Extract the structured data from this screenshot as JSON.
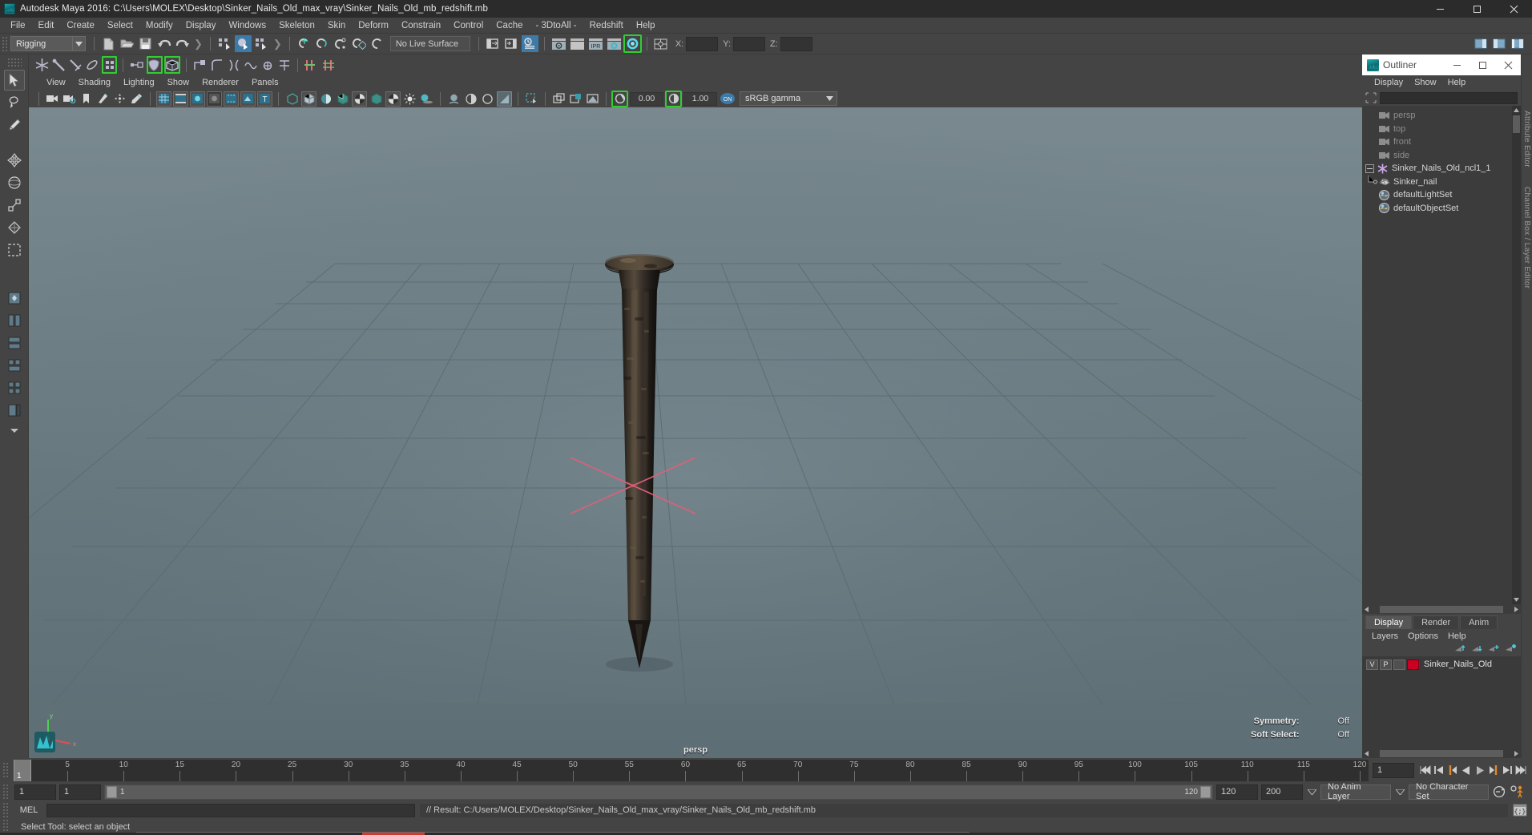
{
  "window": {
    "title": "Autodesk Maya 2016: C:\\Users\\MOLEX\\Desktop\\Sinker_Nails_Old_max_vray\\Sinker_Nails_Old_mb_redshift.mb",
    "app_icon": "maya-icon",
    "minimize": "minimize-icon",
    "maximize": "maximize-icon",
    "close": "close-icon"
  },
  "menubar": {
    "items": [
      {
        "label": "File"
      },
      {
        "label": "Edit"
      },
      {
        "label": "Create"
      },
      {
        "label": "Select"
      },
      {
        "label": "Modify"
      },
      {
        "label": "Display"
      },
      {
        "label": "Windows"
      },
      {
        "label": "Skeleton"
      },
      {
        "label": "Skin"
      },
      {
        "label": "Deform"
      },
      {
        "label": "Constrain"
      },
      {
        "label": "Control"
      },
      {
        "label": "Cache"
      },
      {
        "label": "- 3DtoAll -"
      },
      {
        "label": "Redshift"
      },
      {
        "label": "Help"
      }
    ]
  },
  "statusline": {
    "menu_set": "Rigging",
    "live_surface": "No Live Surface",
    "coord_x_label": "X:",
    "coord_y_label": "Y:",
    "coord_z_label": "Z:",
    "coord_x_value": "",
    "coord_y_value": "",
    "coord_z_value": "",
    "icons": [
      "new-scene-icon",
      "open-scene-icon",
      "save-scene-icon",
      "undo-icon",
      "redo-icon",
      "select-by-hierarchy-icon",
      "select-by-object-icon",
      "select-by-component-icon",
      "snap-to-grid-icon",
      "snap-to-curve-icon",
      "snap-to-point-icon",
      "snap-to-projected-center-icon",
      "snap-to-view-plane-icon",
      "construction-history-icon",
      "render-current-frame-icon",
      "ipr-render-icon",
      "render-settings-icon",
      "hypershade-icon",
      "show-hide-editor-icon",
      "selection-mask-icon"
    ]
  },
  "toolbox": {
    "items": [
      {
        "name": "select-tool",
        "icon": "arrow-select-icon"
      },
      {
        "name": "lasso-tool",
        "icon": "lasso-icon"
      },
      {
        "name": "paint-select-tool",
        "icon": "paint-brush-icon"
      },
      {
        "name": "move-tool",
        "icon": "move-arrows-icon"
      },
      {
        "name": "rotate-tool",
        "icon": "rotate-ring-icon"
      },
      {
        "name": "scale-tool",
        "icon": "scale-box-icon"
      },
      {
        "name": "last-tool",
        "icon": "last-tool-icon"
      },
      {
        "name": "single-pane-layout",
        "icon": "single-pane-icon"
      },
      {
        "name": "two-pane-side-layout",
        "icon": "two-pane-side-icon"
      },
      {
        "name": "two-pane-stacked-layout",
        "icon": "two-pane-stacked-icon"
      },
      {
        "name": "three-pane-layout",
        "icon": "three-pane-icon"
      },
      {
        "name": "four-pane-layout",
        "icon": "four-pane-icon"
      },
      {
        "name": "persp-outliner-layout",
        "icon": "persp-outliner-icon"
      },
      {
        "name": "more-layouts",
        "icon": "chevron-down-icon"
      }
    ]
  },
  "viewport": {
    "panel_menus": [
      {
        "label": "View"
      },
      {
        "label": "Shading"
      },
      {
        "label": "Lighting"
      },
      {
        "label": "Show"
      },
      {
        "label": "Renderer"
      },
      {
        "label": "Panels"
      }
    ],
    "toolbar": {
      "exposure_value": "0.00",
      "gamma_value": "1.00",
      "color_management_toggle": "ON",
      "view_transform": "sRGB gamma",
      "icons": [
        "select-camera-icon",
        "camera-attributes-icon",
        "bookmark-icon",
        "image-plane-icon",
        "two-d-pan-zoom-icon",
        "grease-pencil-icon",
        "grid-toggle-icon",
        "film-gate-icon",
        "resolution-gate-icon",
        "gate-mask-icon",
        "film-origin-icon",
        "xray-icon",
        "text-toggle-icon",
        "wireframe-icon",
        "smooth-shade-icon",
        "shade-wire-icon",
        "hardware-texture-icon",
        "light-toggle-icon",
        "shadow-toggle-icon",
        "ao-toggle-icon",
        "motion-blur-icon",
        "multisample-icon",
        "isolate-select-icon",
        "xray-joints-icon",
        "display-layer-icon",
        "panel-zoom-icon",
        "exposure-icon",
        "contrast-icon"
      ]
    },
    "camera_label": "persp",
    "hud": [
      {
        "key": "Symmetry:",
        "value": "Off"
      },
      {
        "key": "Soft Select:",
        "value": "Off"
      }
    ],
    "scene_object": "Sinker_nail",
    "background_top": "#79898f",
    "background_bottom": "#5e6e75",
    "grid_color": "#55646b",
    "manipulator_color": "#e0607a"
  },
  "outliner": {
    "title": "Outliner",
    "menus": [
      {
        "label": "Display"
      },
      {
        "label": "Show"
      },
      {
        "label": "Help"
      }
    ],
    "search_value": "",
    "tree": [
      {
        "label": "persp",
        "icon": "camera-icon",
        "depth": 1,
        "dim": true,
        "expander": false
      },
      {
        "label": "top",
        "icon": "camera-icon",
        "depth": 1,
        "dim": true,
        "expander": false
      },
      {
        "label": "front",
        "icon": "camera-icon",
        "depth": 1,
        "dim": true,
        "expander": false
      },
      {
        "label": "side",
        "icon": "camera-icon",
        "depth": 1,
        "dim": true,
        "expander": false
      },
      {
        "label": "Sinker_Nails_Old_ncl1_1",
        "icon": "asterisk-icon",
        "depth": 0,
        "dim": false,
        "expander": true
      },
      {
        "label": "Sinker_nail",
        "icon": "mesh-icon",
        "depth": 2,
        "dim": false,
        "expander": false
      },
      {
        "label": "defaultLightSet",
        "icon": "set-icon",
        "depth": 1,
        "dim": false,
        "expander": false
      },
      {
        "label": "defaultObjectSet",
        "icon": "set-icon",
        "depth": 1,
        "dim": false,
        "expander": false
      }
    ]
  },
  "layer_editor": {
    "tabs": [
      {
        "label": "Display",
        "active": true
      },
      {
        "label": "Render",
        "active": false
      },
      {
        "label": "Anim",
        "active": false
      }
    ],
    "menus": [
      {
        "label": "Layers"
      },
      {
        "label": "Options"
      },
      {
        "label": "Help"
      }
    ],
    "buttons": [
      "move-layer-up-icon",
      "move-layer-down-icon",
      "new-layer-icon",
      "new-layer-from-selected-icon"
    ],
    "layers": [
      {
        "visibility": "V",
        "playback": "P",
        "type": "",
        "color": "#cc0022",
        "name": "Sinker_Nails_Old"
      }
    ]
  },
  "attribute_strip": {
    "labels": [
      "Attribute Editor",
      "Channel Box / Layer Editor"
    ]
  },
  "timeslider": {
    "start": 1,
    "end": 120,
    "current_frame": "1",
    "tick_labels": [
      "5",
      "10",
      "15",
      "20",
      "25",
      "30",
      "35",
      "40",
      "45",
      "50",
      "55",
      "60",
      "65",
      "70",
      "75",
      "80",
      "85",
      "90",
      "95",
      "100",
      "105",
      "110",
      "115",
      "120"
    ],
    "current_field": "1",
    "playback_buttons": [
      "go-to-start-icon",
      "step-back-frame-icon",
      "step-back-key-icon",
      "play-backwards-icon",
      "play-forwards-icon",
      "step-forward-key-icon",
      "step-forward-frame-icon",
      "go-to-end-icon"
    ]
  },
  "rangeslider": {
    "anim_start": "1",
    "range_start": "1",
    "range_bar_start": "1",
    "range_end": "120",
    "anim_end": "200",
    "anim_layer": "No Anim Layer",
    "character_set": "No Character Set",
    "auto_keyframe_icon": "auto-keyframe-icon",
    "animation_prefs_icon": "animation-preferences-icon"
  },
  "commandline": {
    "language_label": "MEL",
    "input_value": "",
    "result_text": "// Result: C:/Users/MOLEX/Desktop/Sinker_Nails_Old_max_vray/Sinker_Nails_Old_mb_redshift.mb",
    "script_editor_icon": "script-editor-icon"
  },
  "helpline": {
    "text": "Select Tool: select an object"
  }
}
